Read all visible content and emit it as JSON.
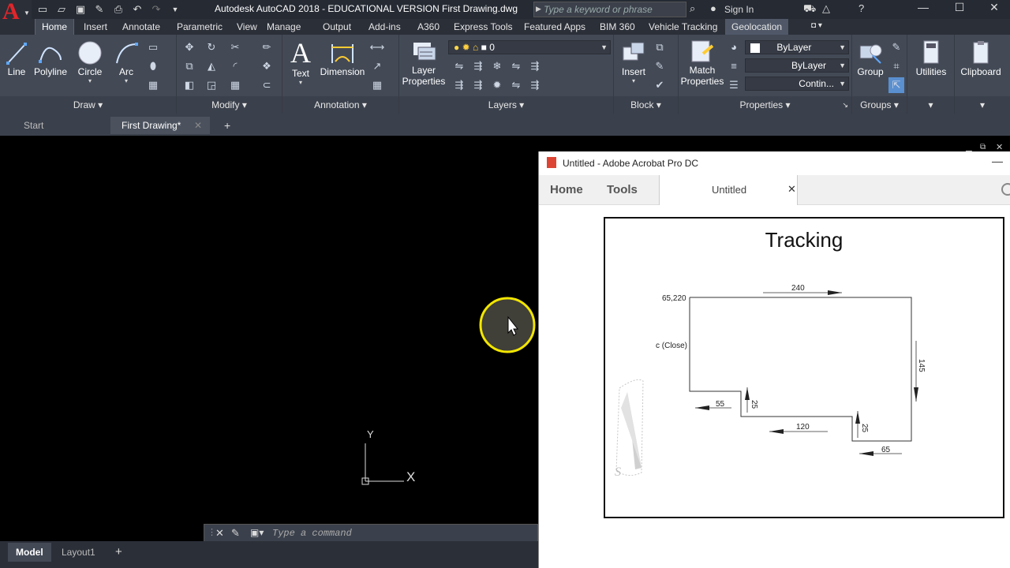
{
  "titlebar": {
    "app_title": "Autodesk AutoCAD 2018 - EDUCATIONAL VERSION",
    "doc_title": "First Drawing.dwg",
    "search_placeholder": "Type a keyword or phrase",
    "sign_in": "Sign In"
  },
  "ribbon_tabs": [
    "Home",
    "Insert",
    "Annotate",
    "Parametric",
    "View",
    "Manage",
    "Output",
    "Add-ins",
    "A360",
    "Express Tools",
    "Featured Apps",
    "BIM 360",
    "Vehicle Tracking",
    "Geolocation"
  ],
  "ribbon": {
    "draw": {
      "label": "Draw",
      "line": "Line",
      "polyline": "Polyline",
      "circle": "Circle",
      "arc": "Arc"
    },
    "modify": {
      "label": "Modify"
    },
    "annotation": {
      "label": "Annotation",
      "text": "Text",
      "dimension": "Dimension"
    },
    "layers": {
      "label": "Layers",
      "layer_properties_1": "Layer",
      "layer_properties_2": "Properties",
      "current_layer": "0"
    },
    "block": {
      "label": "Block",
      "insert": "Insert"
    },
    "properties": {
      "label": "Properties",
      "match_1": "Match",
      "match_2": "Properties",
      "color": "ByLayer",
      "lineweight": "ByLayer",
      "linetype": "Contin..."
    },
    "groups": {
      "label": "Groups",
      "group": "Group"
    },
    "utilities": "Utilities",
    "clipboard": "Clipboard"
  },
  "file_tabs": {
    "start": "Start",
    "drawing": "First Drawing*"
  },
  "canvas": {
    "ucs_y": "Y",
    "ucs_x": "X"
  },
  "command": {
    "placeholder": "Type a command"
  },
  "layout_tabs": {
    "model": "Model",
    "layout1": "Layout1"
  },
  "acrobat": {
    "window_title": "Untitled - Adobe Acrobat Pro DC",
    "nav_home": "Home",
    "nav_tools": "Tools",
    "doc_tab": "Untitled",
    "pdf": {
      "title": "Tracking",
      "start_point": "65,220",
      "close_label": "c (Close)",
      "dims": {
        "top": "240",
        "right": "145",
        "step1_v": "25",
        "step1_h": "55",
        "mid": "120",
        "step2_v": "25",
        "bottom": "65"
      },
      "compass_letter": "S"
    }
  },
  "colors": {
    "ribbon": "#434a56",
    "titlebar": "#252a33",
    "accent_red": "#e0262b",
    "cursor_highlight": "#f2e600"
  }
}
